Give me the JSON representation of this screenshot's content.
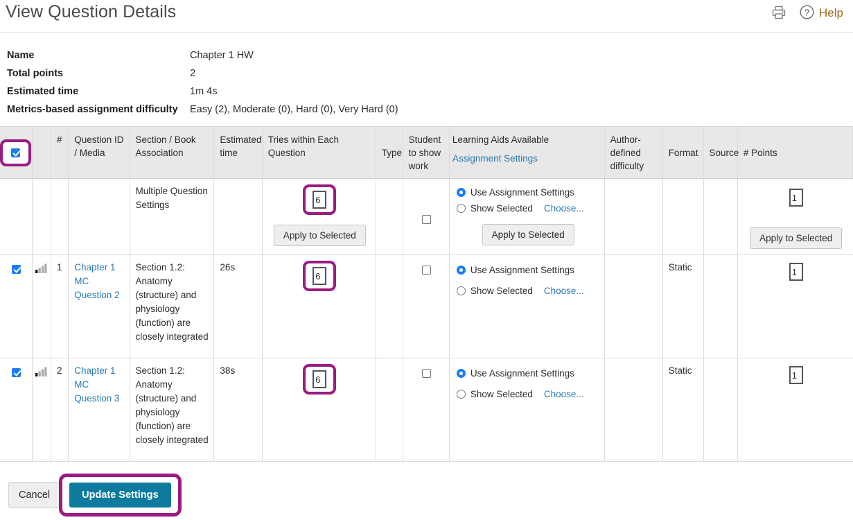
{
  "header": {
    "title": "View Question Details",
    "print_icon": "printer-icon",
    "help_icon": "question-circle-icon",
    "help_label": "Help"
  },
  "meta": [
    {
      "label": "Name",
      "value": "Chapter 1 HW"
    },
    {
      "label": "Total points",
      "value": "2"
    },
    {
      "label": "Estimated time",
      "value": "1m 4s"
    },
    {
      "label": "Metrics-based assignment difficulty",
      "value": "Easy (2), Moderate (0), Hard (0), Very Hard (0)"
    }
  ],
  "table": {
    "headers": {
      "select_all": "",
      "difficulty": "",
      "number": "#",
      "question_id": "Question ID / Media",
      "section": "Section / Book Association",
      "estimated_time": "Estimated time",
      "tries": "Tries within Each Question",
      "type": "Type",
      "show_work": "Student to show work",
      "learning_aids": "Learning Aids Available",
      "learning_aids_link": "Assignment Settings",
      "author_difficulty": "Author-defined difficulty",
      "format": "Format",
      "source": "Source",
      "points": "# Points"
    },
    "settings_row": {
      "section_label": "Multiple Question Settings",
      "tries_value": "6",
      "tries_apply_label": "Apply to Selected",
      "show_work_checked": false,
      "aid_option_use": "Use Assignment Settings",
      "aid_option_show": "Show Selected",
      "aid_choose_link": "Choose...",
      "aids_apply_label": "Apply to Selected",
      "points_value": "1",
      "points_apply_label": "Apply to Selected"
    },
    "rows": [
      {
        "selected": true,
        "difficulty_icon": "bar-chart-difficulty-icon",
        "number": "1",
        "question_id": "Chapter 1 MC Question 2",
        "section": "Section 1.2: Anatomy (structure) and physiology (function) are closely integrated",
        "estimated_time": "26s",
        "tries_value": "6",
        "type": "",
        "show_work_checked": false,
        "aid_option_use": "Use Assignment Settings",
        "aid_option_show": "Show Selected",
        "aid_choose_link": "Choose...",
        "author_difficulty": "",
        "format": "Static",
        "source": "",
        "points_value": "1"
      },
      {
        "selected": true,
        "difficulty_icon": "bar-chart-difficulty-icon",
        "number": "2",
        "question_id": "Chapter 1 MC Question 3",
        "section": "Section 1.2: Anatomy (structure) and physiology (function) are closely integrated",
        "estimated_time": "38s",
        "tries_value": "6",
        "type": "",
        "show_work_checked": false,
        "aid_option_use": "Use Assignment Settings",
        "aid_option_show": "Show Selected",
        "aid_choose_link": "Choose...",
        "author_difficulty": "",
        "format": "Static",
        "source": "",
        "points_value": "1"
      }
    ]
  },
  "footer": {
    "cancel_label": "Cancel",
    "update_label": "Update Settings"
  },
  "colors": {
    "highlight": "#9c1b7f",
    "primary_button": "#0d7b9e",
    "link": "#2a7ab0",
    "help": "#9a6a1f",
    "checkbox": "#1a7ef5",
    "table_header_bg": "#e8e8e8"
  }
}
